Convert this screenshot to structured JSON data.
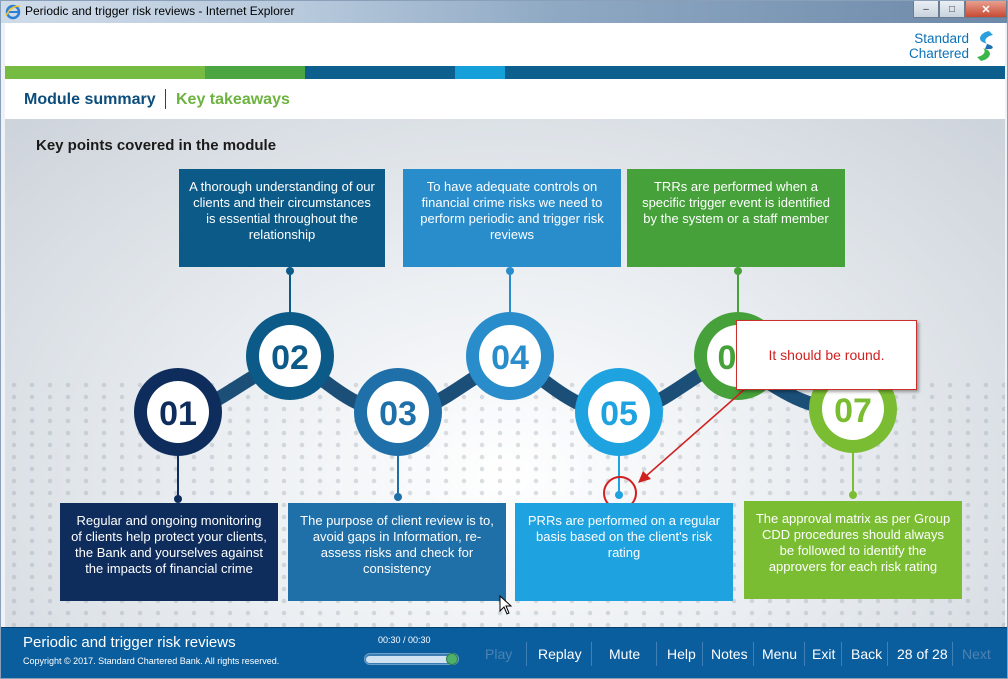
{
  "window": {
    "title": "Periodic and trigger risk reviews - Internet Explorer",
    "buttons": {
      "minimize": "‒",
      "maximize": "□",
      "close": "✕"
    }
  },
  "brand": {
    "line1": "Standard",
    "line2": "Chartered"
  },
  "colors": {
    "stripe": [
      "#76bc43",
      "#4aa542",
      "#0d5f8e",
      "#16a0d9",
      "#0d5f8e"
    ],
    "dark_navy": "#0f2d5c",
    "dark_blue": "#0c5a87",
    "mid_blue": "#1f86c2",
    "light_blue": "#1ea2e0",
    "green": "#46a13a",
    "light_green": "#7abd33",
    "callout_red": "#d02020"
  },
  "nav": {
    "module_summary": "Module summary",
    "key_takeaways": "Key takeaways"
  },
  "main": {
    "heading": "Key points covered in the module",
    "points": [
      {
        "number": "01",
        "text": "Regular and ongoing monitoring of clients help protect your clients, the Bank and yourselves against the impacts of financial crime"
      },
      {
        "number": "02",
        "text": "A thorough understanding of our clients and their circumstances is essential throughout the relationship"
      },
      {
        "number": "03",
        "text": "The purpose of client review is to, avoid gaps in Information, re-assess risks and check for consistency"
      },
      {
        "number": "04",
        "text": "To have adequate controls on financial crime risks we need to perform periodic and trigger risk reviews"
      },
      {
        "number": "05",
        "text": "PRRs are performed on a regular basis based on the client's risk rating"
      },
      {
        "number": "06",
        "text": "TRRs are performed when a specific trigger event is identified by the system or a staff member"
      },
      {
        "number": "07",
        "text": "The approval matrix as per Group CDD procedures should always be followed to identify the approvers for each risk rating"
      }
    ],
    "callout": "It should be round.",
    "visible_circle_06": "0"
  },
  "footer": {
    "title": "Periodic and trigger risk reviews",
    "copyright": "Copyright © 2017. Standard Chartered Bank. All rights reserved.",
    "timer": "00:30 / 00:30",
    "progress": 1.0,
    "buttons": {
      "play": "Play",
      "replay": "Replay",
      "mute": "Mute",
      "help": "Help",
      "notes": "Notes",
      "menu": "Menu",
      "exit": "Exit",
      "back": "Back",
      "page": "28 of 28",
      "next": "Next"
    }
  }
}
